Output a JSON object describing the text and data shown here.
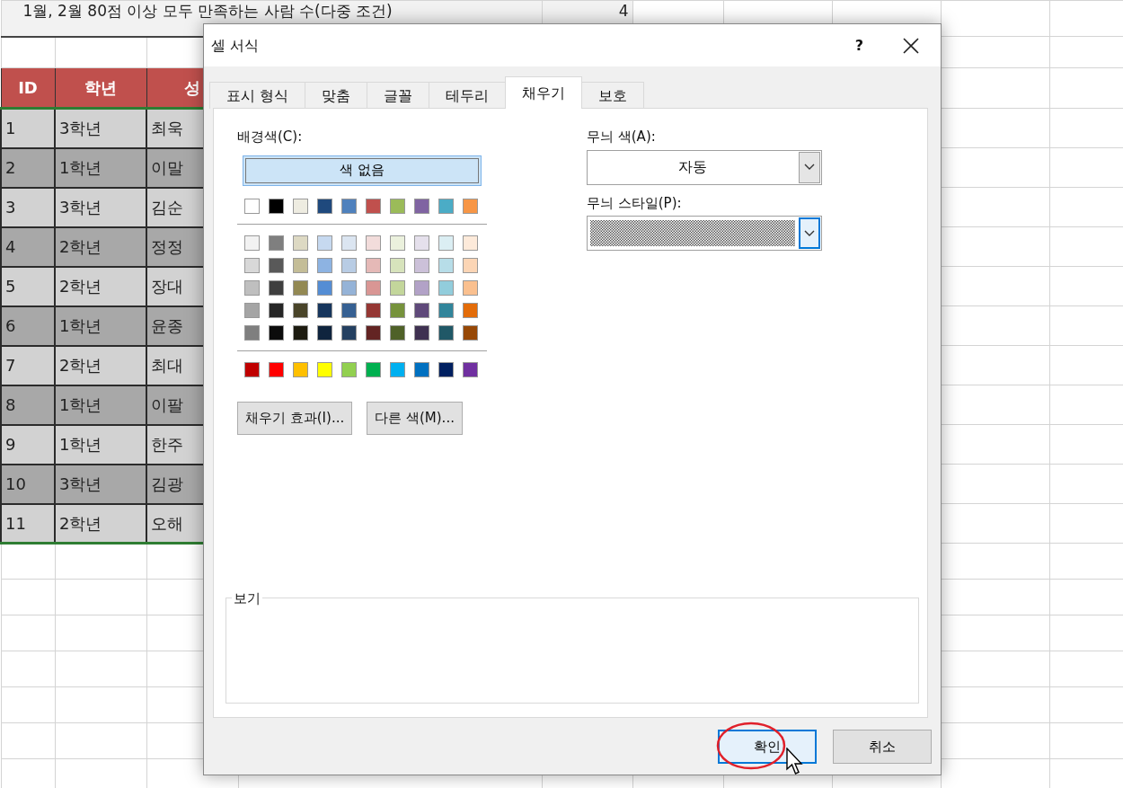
{
  "sheet": {
    "title_cell": "1월, 2월 80점 이상 모두 만족하는 사람 수(다중 조건)",
    "count_cell": "4",
    "headers": [
      "ID",
      "학년",
      "성"
    ],
    "rows": [
      {
        "id": "1",
        "grade": "3학년",
        "name": "최욱"
      },
      {
        "id": "2",
        "grade": "1학년",
        "name": "이말"
      },
      {
        "id": "3",
        "grade": "3학년",
        "name": "김순"
      },
      {
        "id": "4",
        "grade": "2학년",
        "name": "정정"
      },
      {
        "id": "5",
        "grade": "2학년",
        "name": "장대"
      },
      {
        "id": "6",
        "grade": "1학년",
        "name": "윤종"
      },
      {
        "id": "7",
        "grade": "2학년",
        "name": "최대"
      },
      {
        "id": "8",
        "grade": "1학년",
        "name": "이팔"
      },
      {
        "id": "9",
        "grade": "1학년",
        "name": "한주"
      },
      {
        "id": "10",
        "grade": "3학년",
        "name": "김광"
      },
      {
        "id": "11",
        "grade": "2학년",
        "name": "오해"
      }
    ]
  },
  "dialog": {
    "title": "셀 서식",
    "help": "?",
    "tabs": [
      {
        "label": "표시 형식",
        "selected": false
      },
      {
        "label": "맞춤",
        "selected": false
      },
      {
        "label": "글꼴",
        "selected": false
      },
      {
        "label": "테두리",
        "selected": false
      },
      {
        "label": "채우기",
        "selected": true
      },
      {
        "label": "보호",
        "selected": false
      }
    ],
    "background_label": "배경색(C):",
    "no_color": {
      "label": "색 없음",
      "selected": true
    },
    "swatch_groups": [
      {
        "rows": [
          [
            {
              "color": "#ffffff",
              "selected": false
            },
            {
              "color": "#000000",
              "selected": false
            },
            {
              "color": "#eeece1",
              "selected": false
            },
            {
              "color": "#1f497d",
              "selected": false
            },
            {
              "color": "#4f81bd",
              "selected": false
            },
            {
              "color": "#c0504d",
              "selected": false
            },
            {
              "color": "#9bbb59",
              "selected": false
            },
            {
              "color": "#8064a2",
              "selected": false
            },
            {
              "color": "#4bacc6",
              "selected": false
            },
            {
              "color": "#f79646",
              "selected": false
            }
          ]
        ]
      },
      {
        "rows": [
          [
            {
              "color": "#f2f2f2",
              "selected": false
            },
            {
              "color": "#7f7f7f",
              "selected": false
            },
            {
              "color": "#ddd9c3",
              "selected": false
            },
            {
              "color": "#c6d9f0",
              "selected": false
            },
            {
              "color": "#dbe5f1",
              "selected": false
            },
            {
              "color": "#f2dcdb",
              "selected": false
            },
            {
              "color": "#ebf1dd",
              "selected": false
            },
            {
              "color": "#e5e0ec",
              "selected": false
            },
            {
              "color": "#dbeef3",
              "selected": false
            },
            {
              "color": "#fdeada",
              "selected": false
            }
          ],
          [
            {
              "color": "#d8d8d8",
              "selected": false
            },
            {
              "color": "#595959",
              "selected": false
            },
            {
              "color": "#c4bd97",
              "selected": false
            },
            {
              "color": "#8db3e2",
              "selected": false
            },
            {
              "color": "#b8cce4",
              "selected": false
            },
            {
              "color": "#e5b9b7",
              "selected": false
            },
            {
              "color": "#d7e3bc",
              "selected": false
            },
            {
              "color": "#ccc1d9",
              "selected": false
            },
            {
              "color": "#b7dde8",
              "selected": false
            },
            {
              "color": "#fbd5b5",
              "selected": false
            }
          ],
          [
            {
              "color": "#bfbfbf",
              "selected": false
            },
            {
              "color": "#3f3f3f",
              "selected": false
            },
            {
              "color": "#938953",
              "selected": false
            },
            {
              "color": "#548dd4",
              "selected": false
            },
            {
              "color": "#95b3d7",
              "selected": false
            },
            {
              "color": "#d99694",
              "selected": false
            },
            {
              "color": "#c3d69b",
              "selected": false
            },
            {
              "color": "#b2a2c7",
              "selected": false
            },
            {
              "color": "#92cddc",
              "selected": false
            },
            {
              "color": "#fac08f",
              "selected": false
            }
          ],
          [
            {
              "color": "#a5a5a5",
              "selected": false
            },
            {
              "color": "#262626",
              "selected": false
            },
            {
              "color": "#494429",
              "selected": false
            },
            {
              "color": "#17365d",
              "selected": false
            },
            {
              "color": "#366092",
              "selected": false
            },
            {
              "color": "#953734",
              "selected": false
            },
            {
              "color": "#76923c",
              "selected": false
            },
            {
              "color": "#5f497a",
              "selected": false
            },
            {
              "color": "#31859b",
              "selected": false
            },
            {
              "color": "#e36c09",
              "selected": false
            }
          ],
          [
            {
              "color": "#7f7f7f",
              "selected": false
            },
            {
              "color": "#0c0c0c",
              "selected": false
            },
            {
              "color": "#1d1b10",
              "selected": false
            },
            {
              "color": "#0f243e",
              "selected": false
            },
            {
              "color": "#244061",
              "selected": false
            },
            {
              "color": "#632423",
              "selected": false
            },
            {
              "color": "#4f6128",
              "selected": false
            },
            {
              "color": "#3f3151",
              "selected": false
            },
            {
              "color": "#205867",
              "selected": false
            },
            {
              "color": "#974806",
              "selected": false
            }
          ]
        ]
      },
      {
        "rows": [
          [
            {
              "color": "#c00000",
              "selected": false
            },
            {
              "color": "#ff0000",
              "selected": false
            },
            {
              "color": "#ffc000",
              "selected": false
            },
            {
              "color": "#ffff00",
              "selected": false
            },
            {
              "color": "#92d050",
              "selected": false
            },
            {
              "color": "#00b050",
              "selected": false
            },
            {
              "color": "#00b0f0",
              "selected": false
            },
            {
              "color": "#0070c0",
              "selected": false
            },
            {
              "color": "#002060",
              "selected": false
            },
            {
              "color": "#7030a0",
              "selected": false
            }
          ]
        ]
      }
    ],
    "left_buttons": [
      "채우기 효과(I)...",
      "다른 색(M)..."
    ],
    "pattern_color": {
      "label": "무늬 색(A):",
      "value": "자동",
      "focused": false
    },
    "pattern_style": {
      "label": "무늬 스타일(P):",
      "focused": true
    },
    "preview_label": "보기",
    "buttons": [
      {
        "label": "확인",
        "default": true
      },
      {
        "label": "취소",
        "default": false
      }
    ]
  }
}
